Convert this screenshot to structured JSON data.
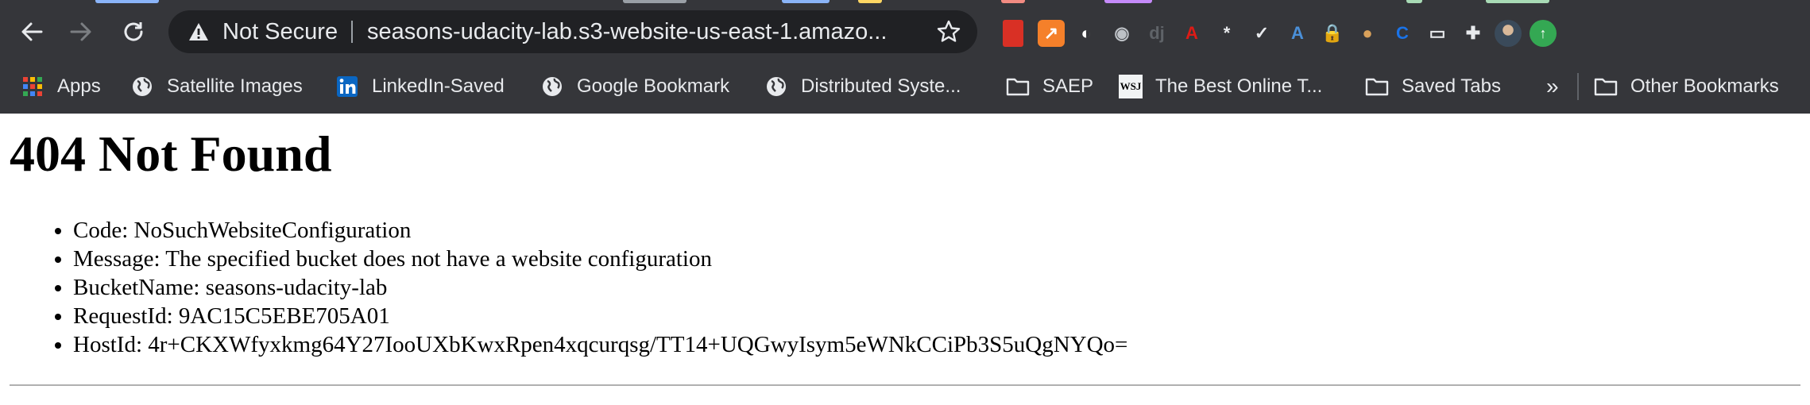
{
  "browser": {
    "security_label": "Not Secure",
    "url": "seasons-udacity-lab.s3-website-us-east-1.amazo...",
    "tab_colors": [
      "#8ab4f8",
      "#fdd663",
      "#f28b82",
      "#a8dab5",
      "#c58af9"
    ]
  },
  "extensions": [
    {
      "name": "bookmark-ext-icon",
      "color": "#e94235",
      "glyph": ""
    },
    {
      "name": "chart-ext-icon",
      "color": "#f5802a",
      "glyph": "↗"
    },
    {
      "name": "contrast-ext-icon",
      "color": "#ffffff",
      "glyph": "◐"
    },
    {
      "name": "record-ext-icon",
      "color": "#bdc1c6",
      "glyph": "◉"
    },
    {
      "name": "django-ext-icon",
      "color": "#5f6368",
      "glyph": "dj"
    },
    {
      "name": "angular-ext-icon",
      "color": "#dd1b16",
      "glyph": "A"
    },
    {
      "name": "password-ext-icon",
      "color": "#e8eaed",
      "glyph": "*"
    },
    {
      "name": "notes-ext-icon",
      "color": "#e8eaed",
      "glyph": "✓"
    },
    {
      "name": "translate-ext-icon",
      "color": "#4a90d9",
      "glyph": "A"
    },
    {
      "name": "lock-ext-icon",
      "color": "#d93025",
      "glyph": "🔒"
    },
    {
      "name": "cookie-ext-icon",
      "color": "#d9a15b",
      "glyph": "●"
    },
    {
      "name": "sync-ext-icon",
      "color": "#1a73e8",
      "glyph": "C"
    },
    {
      "name": "window-ext-icon",
      "color": "#e8eaed",
      "glyph": "▭"
    },
    {
      "name": "puzzle-extensions-icon",
      "color": "#e8eaed",
      "glyph": "✚"
    },
    {
      "name": "profile-avatar",
      "color": "#7a8a99",
      "glyph": ""
    },
    {
      "name": "update-icon",
      "color": "#34a853",
      "glyph": "↑"
    }
  ],
  "bookmarks": {
    "apps": "Apps",
    "satellite": "Satellite Images",
    "linkedin": "LinkedIn-Saved",
    "google": "Google Bookmark",
    "distributed": "Distributed Syste...",
    "saep": "SAEP",
    "wsj_icon": "WSJ",
    "wsj": "The Best Online T...",
    "saved_tabs": "Saved Tabs",
    "overflow": "»",
    "other": "Other Bookmarks"
  },
  "page": {
    "heading": "404 Not Found",
    "details": [
      "Code: NoSuchWebsiteConfiguration",
      "Message: The specified bucket does not have a website configuration",
      "BucketName: seasons-udacity-lab",
      "RequestId: 9AC15C5EBE705A01",
      "HostId: 4r+CKXWfyxkmg64Y27IooUXbKwxRpen4xqcurqsg/TT14+UQGwyIsym5eWNkCCiPb3S5uQgNYQo="
    ]
  }
}
